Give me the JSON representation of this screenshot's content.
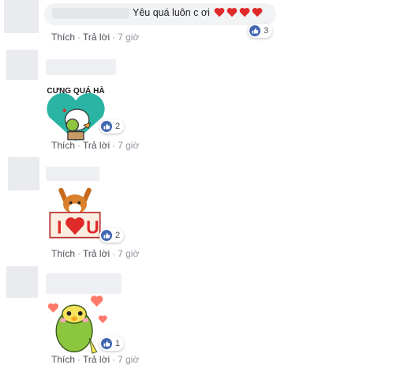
{
  "comments": [
    {
      "text": "Yêu quá luôn c ơi",
      "hearts": [
        "heart",
        "heart",
        "heart",
        "heart"
      ],
      "reaction_count": "3",
      "like_label": "Thích",
      "reply_label": "Trả lời",
      "time": "7 giờ"
    },
    {
      "sticker": "CƯNG QUÁ HÀ",
      "reaction_count": "2",
      "like_label": "Thích",
      "reply_label": "Trả lời",
      "time": "7 giờ"
    },
    {
      "sticker": "I ♥ U",
      "sticker_text": "I",
      "sticker_text2": "U",
      "reaction_count": "2",
      "like_label": "Thích",
      "reply_label": "Trả lời",
      "time": "7 giờ"
    },
    {
      "sticker": "parrot-hearts",
      "reaction_count": "1",
      "like_label": "Thích",
      "reply_label": "Trả lời",
      "time": "7 giờ"
    }
  ],
  "colors": {
    "like_blue": "#4267b2",
    "heart_red": "#e02a2a",
    "sticker_teal": "#2ab4a4"
  }
}
